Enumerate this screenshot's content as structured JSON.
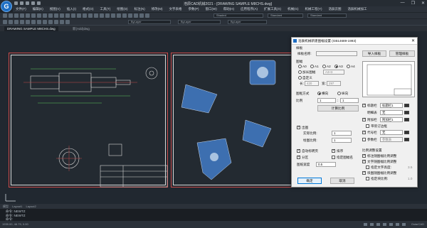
{
  "app": {
    "logo_letter": "G",
    "window_title": "浩辰CAD机械2021 - [DRAWING SAMPLE M8CHS.dwg]",
    "window_controls": [
      "—",
      "❐",
      "✕"
    ]
  },
  "menu": [
    "文件(F)",
    "编辑(E)",
    "视图(V)",
    "插入(I)",
    "格式(O)",
    "工具(T)",
    "绘图(D)",
    "标注(N)",
    "修改(M)",
    "文字表格",
    "参数(P)",
    "窗口(W)",
    "帮助(H)",
    "应用程序(A)",
    "扩展工具(X)",
    "机械(G)",
    "机械工程(Y)",
    "浩辰云图",
    "浩辰机械加工"
  ],
  "toolbar": {
    "layer_combo": "Shaded",
    "linetype_combo": "ByLayer",
    "color_combo": "ByLayer",
    "style_combo": "Standard",
    "lineweight_combo": "ByLayer",
    "style_combo2": "Standard"
  },
  "doc_tabs": [
    {
      "label": "DRAWING SAMPLE M8CHS.dwg",
      "active": true
    },
    {
      "label": "新(Add)dwg",
      "active": false
    }
  ],
  "model_tabs": [
    "模型",
    "Layout1",
    "Layout2"
  ],
  "command_lines": [
    "命令: NEWTZ",
    "命令: NEWTZ",
    "命令:"
  ],
  "status": {
    "coords": "1939.00, 46.79, 0.00",
    "brand": "GstarCAD"
  },
  "dialog": {
    "title": "浩辰机械新建图幅设置  (GB14689-1993)",
    "close_glyph": "✕",
    "style_group": "样板",
    "style_name_label": "样板名称:",
    "import_button": "导入样板",
    "manage_button": "管理样板",
    "frame_group": "图幅",
    "sizes": [
      "A0",
      "A1",
      "A2",
      "A3",
      "A4"
    ],
    "selected_size": "A3",
    "extended_label": "加长图幅",
    "extended_value": "A3×3",
    "custom_label": "自定义",
    "width_label": "长:",
    "width_value": "420",
    "height_label": "宽:",
    "height_value": "297",
    "orientation_label": "图框方式",
    "orientation_h": "横向",
    "orientation_v": "纵向",
    "scale_label": "比例",
    "scale_left": "1",
    "scale_right": "1",
    "scale_colon": ":",
    "calc_scale_button": "计算比例",
    "fix_scale_label": "出图",
    "real_scale_label": "实际比例:",
    "real_scale_value": "1",
    "draw_scale_label": "绘图比例:",
    "draw_scale_value": "1",
    "auto_label_number": "自动标明页",
    "unit_label": "排序",
    "zone_label": "分区",
    "zone2_label": "指定图幅名",
    "thickness_label": "图纸宽度",
    "thickness_value": "0.5",
    "ok_button": "确定",
    "cancel_button": "取消",
    "right": {
      "title_block_label": "标题栏",
      "title_block_value": "标题栏1",
      "detail_label": "明细表",
      "detail_value": "无",
      "additional_label": "附加栏",
      "additional_value": "附加栏1",
      "add_frame_label": "带装订边框",
      "code_label": "代号栏",
      "code_value": "无",
      "params_label": "参数栏",
      "params_value": "参数表",
      "scale_options_title": "比例调整设置",
      "opt1": "标注随图幅比例调整",
      "opt2": "文字随图幅比例调整",
      "opt2a": "指定文字高度:",
      "opt2a_value": "3.5",
      "opt3": "块图随图幅比例调整",
      "opt3a": "指定块比例:",
      "opt3a_value": "1.0",
      "edit_glyph": "…"
    }
  }
}
